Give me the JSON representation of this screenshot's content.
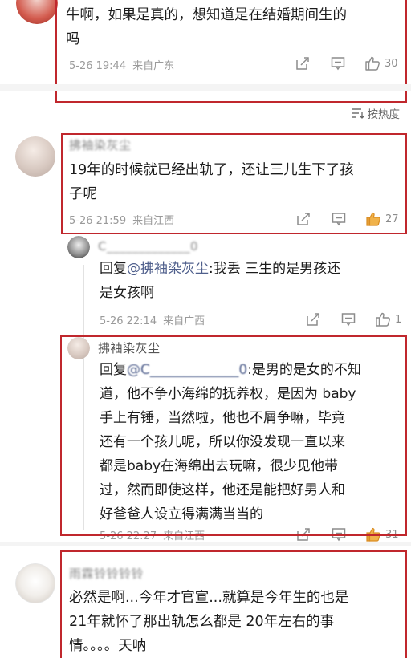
{
  "comments": [
    {
      "text_lines": [
        "牛啊，如果是真的，想知道是在结婚期间生的",
        "吗"
      ],
      "date": "5-26 19:44",
      "location": "来自广东",
      "likes": "30"
    },
    {
      "author": "拂袖染灰尘",
      "text_lines": [
        "19年的时候就已经出轨了，还让三儿生下了孩",
        "子呢"
      ],
      "date": "5-26 21:59",
      "location": "来自江西",
      "likes": "27"
    },
    {
      "author": "C_____________0",
      "reply_prefix": "回复",
      "reply_at": "@拂袖染灰尘",
      "text_lines": [
        ":我丢 三生的是男孩还",
        "是女孩啊"
      ],
      "date": "5-26 22:14",
      "location": "来自广西",
      "likes": "1"
    },
    {
      "author": "拂袖染灰尘",
      "reply_prefix": "回复",
      "reply_at": "@C_____________0",
      "text_lines": [
        ":是男的是女的不知",
        "道，他不争小海绵的抚养权，是因为 baby",
        "手上有锤，当然啦，他也不屑争嘛，毕竟",
        "还有一个孩儿呢，所以你没发现一直以来",
        "都是baby在海绵出去玩嘛，很少见他带",
        "过，然而即使这样，他还是能把好男人和",
        "好爸爸人设立得满满当当的"
      ],
      "date": "5-26 22:27",
      "location": "来自江西",
      "likes": "31"
    },
    {
      "author": "雨霖铃铃铃铃",
      "text_lines": [
        "必然是啊...今年才官宣...就算是今年生的也是",
        "21年就怀了那出轨怎么都是 20年左右的事",
        "情。。。。天呐"
      ]
    }
  ],
  "sort_label": "按热度",
  "colors": {
    "highlight_box": "#c0272d",
    "liked": "#e8a33b",
    "mention": "#4f5f8c"
  },
  "icons": {
    "repost": "repost-icon",
    "comment": "comment-icon",
    "like": "thumbs-up-icon",
    "sort": "sort-icon"
  }
}
